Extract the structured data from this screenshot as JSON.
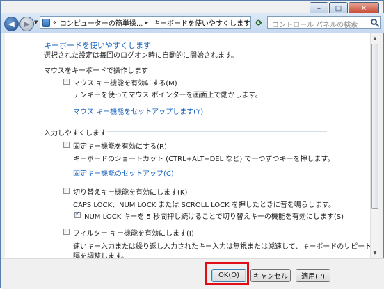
{
  "window": {
    "caption_buttons": {
      "minimize": "–",
      "maximize": "□",
      "close": "✕"
    }
  },
  "toolbar": {
    "back_icon": "back-arrow-icon",
    "forward_icon": "forward-arrow-icon",
    "breadcrumb": {
      "prefix": "«",
      "items": [
        "コンピューターの簡単操...",
        "キーボードを使いやすくします"
      ],
      "separator": "▸"
    },
    "search_placeholder": "コントロール パネルの検索"
  },
  "main": {
    "title": "キーボードを使いやすくします",
    "subtitle": "選択された設定は毎回のログオン時に自動的に開始されます。",
    "section_mouse": {
      "heading": "マウスをキーボードで操作します",
      "mouse_keys": {
        "label": "マウス キー機能を有効にする(M)",
        "checked": false,
        "description": "テンキーを使ってマウス ポインターを画面上で動かします。",
        "setup_link": "マウス キー機能をセットアップします(Y)"
      }
    },
    "section_typing": {
      "heading": "入力しやすくします",
      "sticky_keys": {
        "label": "固定キー機能を有効にする(R)",
        "checked": false,
        "description": "キーボードのショートカット (CTRL+ALT+DEL など) で一つずつキーを押します。",
        "setup_link": "固定キー機能のセットアップ(C)"
      },
      "toggle_keys": {
        "label": "切り替えキー機能を有効にします(K)",
        "checked": false,
        "description": "CAPS LOCK、NUM LOCK または SCROLL LOCK を押したときに音を鳴らします。",
        "sub_option": {
          "label": "NUM LOCK キーを 5 秒間押し続けることで切り替えキーの機能を有効にします(S)",
          "checked": true
        }
      },
      "filter_keys": {
        "label": "フィルター キー機能を有効にします(I)",
        "checked": false,
        "description_line1": "速いキー入力または繰り返し入力されたキー入力は無視または減速して、キーボードのリピート間",
        "description_line2": "隔を調整します。"
      }
    }
  },
  "buttons": {
    "ok": "OK(O)",
    "cancel": "キャンセル",
    "apply": "適用(P)"
  },
  "colors": {
    "link": "#1560bd",
    "highlight": "#e10e16"
  }
}
